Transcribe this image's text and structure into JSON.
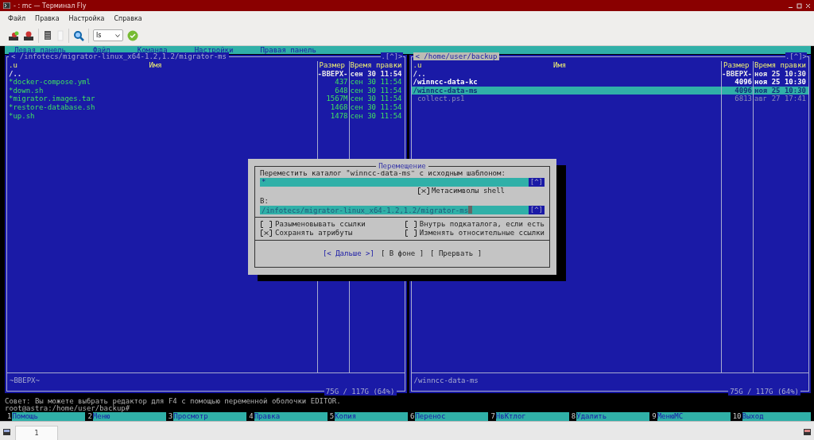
{
  "window": {
    "title": "- : mc — Терминал Fly"
  },
  "menu": [
    {
      "label": "Файл"
    },
    {
      "label": "Правка"
    },
    {
      "label": "Настройка"
    },
    {
      "label": "Справка"
    }
  ],
  "toolbar": {
    "command": "ls"
  },
  "mc": {
    "menubar": [
      "Левая панель",
      "Файл",
      "Команда",
      "Настройки",
      "Правая панель"
    ],
    "panels": [
      {
        "active": false,
        "nav_left": "<",
        "path": "/infotecs/migrator-linux_x64-1.2,1.2/migrator-ms",
        "nav_right": ".[^]>",
        "columns": [
          ".u",
          "Имя",
          "Размер",
          "Время правки"
        ],
        "rows": [
          {
            "name": "/..",
            "size": "-ВВЕРХ-",
            "time": "сен 30 11:54",
            "kind": "updir",
            "selected": false
          },
          {
            "name": "*docker-compose.yml",
            "size": "437",
            "time": "сен 30 11:54",
            "kind": "exec",
            "selected": false
          },
          {
            "name": "*down.sh",
            "size": "648",
            "time": "сен 30 11:54",
            "kind": "exec",
            "selected": false
          },
          {
            "name": "*migrator.images.tar",
            "size": "1567M",
            "time": "сен 30 11:54",
            "kind": "exec",
            "selected": false
          },
          {
            "name": "*restore-database.sh",
            "size": "1468",
            "time": "сен 30 11:54",
            "kind": "exec",
            "selected": false
          },
          {
            "name": "*up.sh",
            "size": "1478",
            "time": "сен 30 11:54",
            "kind": "exec",
            "selected": false
          }
        ],
        "footer_left": "~ВВЕРХ~",
        "footer_right": "75G / 117G (64%)"
      },
      {
        "active": true,
        "nav_left": "<",
        "path": "/home/user/backup",
        "nav_right": ".[^]>",
        "columns": [
          ".u",
          "Имя",
          "Размер",
          "Время правки"
        ],
        "rows": [
          {
            "name": "/..",
            "size": "-ВВЕРХ-",
            "time": "ноя 25 10:30",
            "kind": "updir",
            "selected": false
          },
          {
            "name": "/winncc-data-kc",
            "size": "4096",
            "time": "ноя 25 10:30",
            "kind": "dir",
            "selected": false
          },
          {
            "name": "/winncc-data-ms",
            "size": "4096",
            "time": "ноя 25 10:30",
            "kind": "dir",
            "selected": true
          },
          {
            "name": " collect.ps1",
            "size": "6813",
            "time": "авг 27 17:41",
            "kind": "backup",
            "selected": false
          }
        ],
        "footer_left": "/winncc-data-ms",
        "footer_right": "75G / 117G (64%)"
      }
    ],
    "dialog": {
      "title": "Перемещение",
      "source_label": "Переместить каталог \"winncc-data-ms\" с исходным шаблоном:",
      "source_value": "*",
      "history_button": "[^]",
      "shell_option": {
        "label": "Метасимволы shell",
        "checked": true
      },
      "target_label": "В:",
      "target_value": "/infotecs/migrator-linux_x64-1.2,1.2/migrator-ms",
      "options": [
        {
          "label": "Разыменовывать ссылки",
          "checked": false
        },
        {
          "label": "Внутрь подкаталога, если есть",
          "checked": false
        },
        {
          "label": "Сохранять атрибуты",
          "checked": true
        },
        {
          "label": "Изменять относительные ссылки",
          "checked": false
        }
      ],
      "buttons": [
        {
          "label": "[< Дальше >]",
          "selected": true
        },
        {
          "label": "[ В фоне ]",
          "selected": false
        },
        {
          "label": "[ Прервать ]",
          "selected": false
        }
      ]
    },
    "hint": "Совет: Вы можете выбрать редактор для F4 с помощью переменной оболочки EDITOR.",
    "prompt": "root@astra:/home/user/backup#",
    "function_keys": [
      {
        "num": "1",
        "label": "Помощь"
      },
      {
        "num": "2",
        "label": "Меню"
      },
      {
        "num": "3",
        "label": "Просмотр"
      },
      {
        "num": "4",
        "label": "Правка"
      },
      {
        "num": "5",
        "label": "Копия"
      },
      {
        "num": "6",
        "label": "Перенос"
      },
      {
        "num": "7",
        "label": "НвКтлог"
      },
      {
        "num": "8",
        "label": "Удалить"
      },
      {
        "num": "9",
        "label": "МенюMC"
      },
      {
        "num": "10",
        "label": "Выход"
      }
    ]
  },
  "taskbar": {
    "tabs": [
      {
        "label": "1",
        "selected": true
      }
    ]
  }
}
